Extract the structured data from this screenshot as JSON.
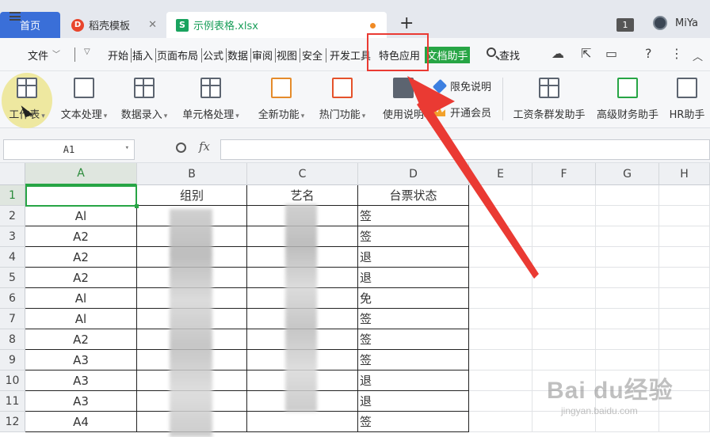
{
  "tabs": {
    "home": "首页",
    "daoke": "稻壳模板",
    "file": "示例表格.xlsx",
    "add": "+"
  },
  "titlebar": {
    "window_count": "1",
    "username": "MiYa"
  },
  "menu": {
    "file": "文件",
    "items": [
      "开始",
      "插入",
      "页面布局",
      "公式",
      "数据",
      "审阅",
      "视图",
      "安全",
      "开发工具",
      "特色应用",
      "文档助手"
    ],
    "search": "查找"
  },
  "ribbon": {
    "worksheet": "工作表",
    "text_processing": "文本处理",
    "data_entry": "数据录入",
    "cell_processing": "单元格处理",
    "new_features": "全新功能",
    "hot_features": "热门功能",
    "usage_help": "使用说明",
    "free_limited": "限免说明",
    "open_vip": "开通会员",
    "payroll": "工资条群发助手",
    "finance": "高级财务助手",
    "hr": "HR助手"
  },
  "formula": {
    "cell_ref": "A1",
    "fx": "fx"
  },
  "grid": {
    "columns": [
      "A",
      "B",
      "C",
      "D",
      "E",
      "F",
      "G",
      "H"
    ],
    "rows": [
      "1",
      "2",
      "3",
      "4",
      "5",
      "6",
      "7",
      "8",
      "9",
      "10",
      "11",
      "12"
    ],
    "header": {
      "A": "",
      "B": "组别",
      "C": "艺名",
      "D": "台票状态"
    },
    "col_a": [
      "Al",
      "A2",
      "A2",
      "A2",
      "Al",
      "Al",
      "A2",
      "A3",
      "A3",
      "A3",
      "A4"
    ],
    "col_d": [
      "签",
      "签",
      "退",
      "退",
      "免",
      "签",
      "签",
      "签",
      "退",
      "退",
      "签"
    ]
  },
  "watermark": {
    "brand": "Bai du经验",
    "url": "jingyan.baidu.com"
  },
  "colors": {
    "accent_green": "#27a545",
    "home_tab": "#3a6fd8",
    "highlight_red": "#ea3a33"
  }
}
